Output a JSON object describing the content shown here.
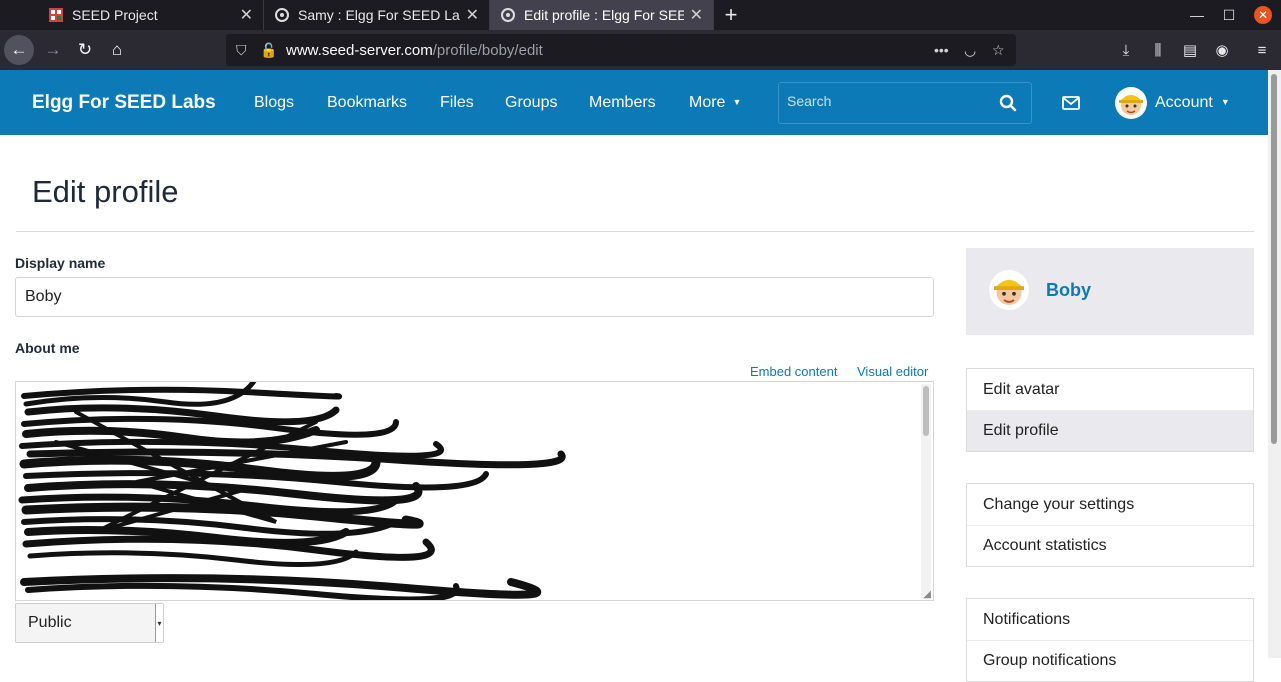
{
  "browser": {
    "tabs": [
      {
        "title": "SEED Project",
        "active": false
      },
      {
        "title": "Samy : Elgg For SEED Labs",
        "active": false
      },
      {
        "title": "Edit profile : Elgg For SEED Labs",
        "active": true
      }
    ],
    "url_host": "www.seed-server.com",
    "url_path": "/profile/boby/edit"
  },
  "topbar": {
    "brand": "Elgg For SEED Labs",
    "menu": [
      "Blogs",
      "Bookmarks",
      "Files",
      "Groups",
      "Members",
      "More"
    ],
    "search_placeholder": "Search",
    "account_label": "Account"
  },
  "page": {
    "title": "Edit profile",
    "display_name_label": "Display name",
    "display_name_value": "Boby",
    "about_me_label": "About me",
    "embed_content": "Embed content",
    "visual_editor": "Visual editor",
    "access_value": "Public"
  },
  "sidebar": {
    "owner_name": "Boby",
    "group1": [
      {
        "label": "Edit avatar",
        "selected": false
      },
      {
        "label": "Edit profile",
        "selected": true
      }
    ],
    "group2": [
      {
        "label": "Change your settings"
      },
      {
        "label": "Account statistics"
      }
    ],
    "group3": [
      {
        "label": "Notifications"
      },
      {
        "label": "Group notifications"
      }
    ]
  },
  "colors": {
    "brand_blue": "#0b7ab6",
    "selected_bg": "#e9e9ee"
  }
}
